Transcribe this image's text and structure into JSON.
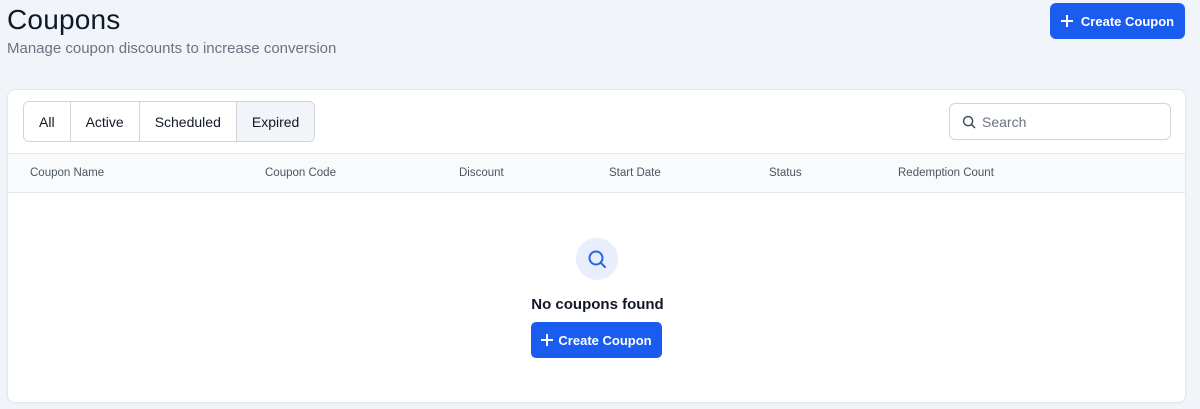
{
  "header": {
    "title": "Coupons",
    "subtitle": "Manage coupon discounts to increase conversion",
    "create_button_label": "Create Coupon"
  },
  "tabs": [
    {
      "label": "All",
      "selected": false
    },
    {
      "label": "Active",
      "selected": false
    },
    {
      "label": "Scheduled",
      "selected": false
    },
    {
      "label": "Expired",
      "selected": true
    }
  ],
  "search": {
    "placeholder": "Search",
    "value": ""
  },
  "table": {
    "columns": [
      "Coupon Name",
      "Coupon Code",
      "Discount",
      "Start Date",
      "Status",
      "Redemption Count"
    ],
    "rows": []
  },
  "empty_state": {
    "icon": "search-icon",
    "title": "No coupons found",
    "button_label": "Create Coupon"
  },
  "colors": {
    "primary": "#1a5cf0",
    "background": "#f1f5f9",
    "card": "#ffffff",
    "border": "#d1d5db",
    "empty_icon_bg": "#e8eefb"
  }
}
